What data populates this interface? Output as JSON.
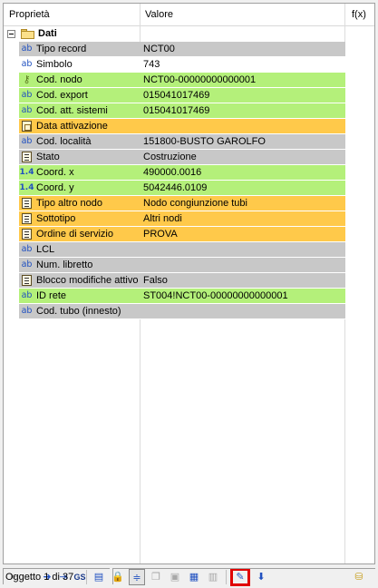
{
  "grid": {
    "columns": [
      "Proprietà",
      "Valore",
      "f(x)"
    ],
    "group": {
      "label": "Dati",
      "expander": "minus",
      "icon": "folder-icon"
    },
    "rows": [
      {
        "icon": "text-icon",
        "glyph": "ab",
        "key": "Tipo record",
        "value": "NCT00",
        "color": "gray"
      },
      {
        "icon": "text-icon",
        "glyph": "ab",
        "key": "Simbolo",
        "value": "743",
        "color": "white"
      },
      {
        "icon": "key-icon",
        "glyph": "⚷",
        "key": "Cod. nodo",
        "value": "NCT00-00000000000001",
        "color": "green"
      },
      {
        "icon": "text-icon",
        "glyph": "ab",
        "key": "Cod. export",
        "value": "015041017469",
        "color": "green"
      },
      {
        "icon": "text-icon",
        "glyph": "ab",
        "key": "Cod. att. sistemi",
        "value": "015041017469",
        "color": "green"
      },
      {
        "icon": "calendar-icon",
        "glyph": "",
        "key": "Data attivazione",
        "value": "",
        "color": "orange"
      },
      {
        "icon": "text-icon",
        "glyph": "ab",
        "key": "Cod. località",
        "value": "151800-BUSTO GAROLFO",
        "color": "gray"
      },
      {
        "icon": "list-icon",
        "glyph": "",
        "key": "Stato",
        "value": "Costruzione",
        "color": "gray"
      },
      {
        "icon": "number-icon",
        "glyph": "1.4",
        "key": "Coord. x",
        "value": "490000.0016",
        "color": "green"
      },
      {
        "icon": "number-icon",
        "glyph": "1.4",
        "key": "Coord. y",
        "value": "5042446.0109",
        "color": "green"
      },
      {
        "icon": "list-icon",
        "glyph": "",
        "key": "Tipo altro nodo",
        "value": "Nodo congiunzione tubi",
        "color": "orange"
      },
      {
        "icon": "list-icon",
        "glyph": "",
        "key": "Sottotipo",
        "value": "Altri nodi",
        "color": "orange"
      },
      {
        "icon": "list-icon",
        "glyph": "",
        "key": "Ordine di servizio",
        "value": "PROVA",
        "color": "orange"
      },
      {
        "icon": "text-icon",
        "glyph": "ab",
        "key": "LCL",
        "value": "",
        "color": "gray"
      },
      {
        "icon": "text-icon",
        "glyph": "ab",
        "key": "Num. libretto",
        "value": "",
        "color": "gray"
      },
      {
        "icon": "list-icon",
        "glyph": "",
        "key": "Blocco modifiche attivo",
        "value": "Falso",
        "color": "gray"
      },
      {
        "icon": "text-icon",
        "glyph": "ab",
        "key": "ID rete",
        "value": "ST004!NCT00-00000000000001",
        "color": "green"
      },
      {
        "icon": "text-icon",
        "glyph": "ab",
        "key": "Cod. tubo (innesto)",
        "value": "",
        "color": "gray"
      }
    ]
  },
  "toolbar": {
    "buttons": [
      {
        "name": "first-record-icon",
        "glyph": "⇤",
        "disabled": true
      },
      {
        "name": "previous-record-icon",
        "glyph": "←",
        "disabled": true
      },
      {
        "name": "next-record-icon",
        "glyph": "➜",
        "disabled": false
      },
      {
        "name": "last-record-icon",
        "glyph": "⇥",
        "disabled": false
      },
      {
        "name": "gs-icon",
        "glyph": "GS",
        "disabled": false
      },
      {
        "name": "copy-record-icon",
        "glyph": "▤",
        "disabled": false
      },
      {
        "name": "lock-icon",
        "glyph": "🔒",
        "disabled": true
      },
      {
        "name": "align-icon",
        "glyph": "≑",
        "disabled": false,
        "pressed": true
      },
      {
        "name": "document-copy-icon",
        "glyph": "❐",
        "disabled": true
      },
      {
        "name": "paste-icon",
        "glyph": "▣",
        "disabled": true
      },
      {
        "name": "table-icon",
        "glyph": "▦",
        "disabled": false
      },
      {
        "name": "grid-view-icon",
        "glyph": "▥",
        "disabled": true
      },
      {
        "name": "edit-form-icon",
        "glyph": "✎",
        "disabled": false,
        "highlight": true
      },
      {
        "name": "save-form-icon",
        "glyph": "⬇",
        "disabled": false
      },
      {
        "name": "database-icon",
        "glyph": "⛁",
        "disabled": false
      }
    ]
  },
  "status": {
    "record_info": "Oggetto 1 di 37",
    "right": ""
  },
  "colors": {
    "gray": "#c8c8c8",
    "green": "#b4f07a",
    "orange": "#ffc94a",
    "highlight_border": "#e00000"
  }
}
